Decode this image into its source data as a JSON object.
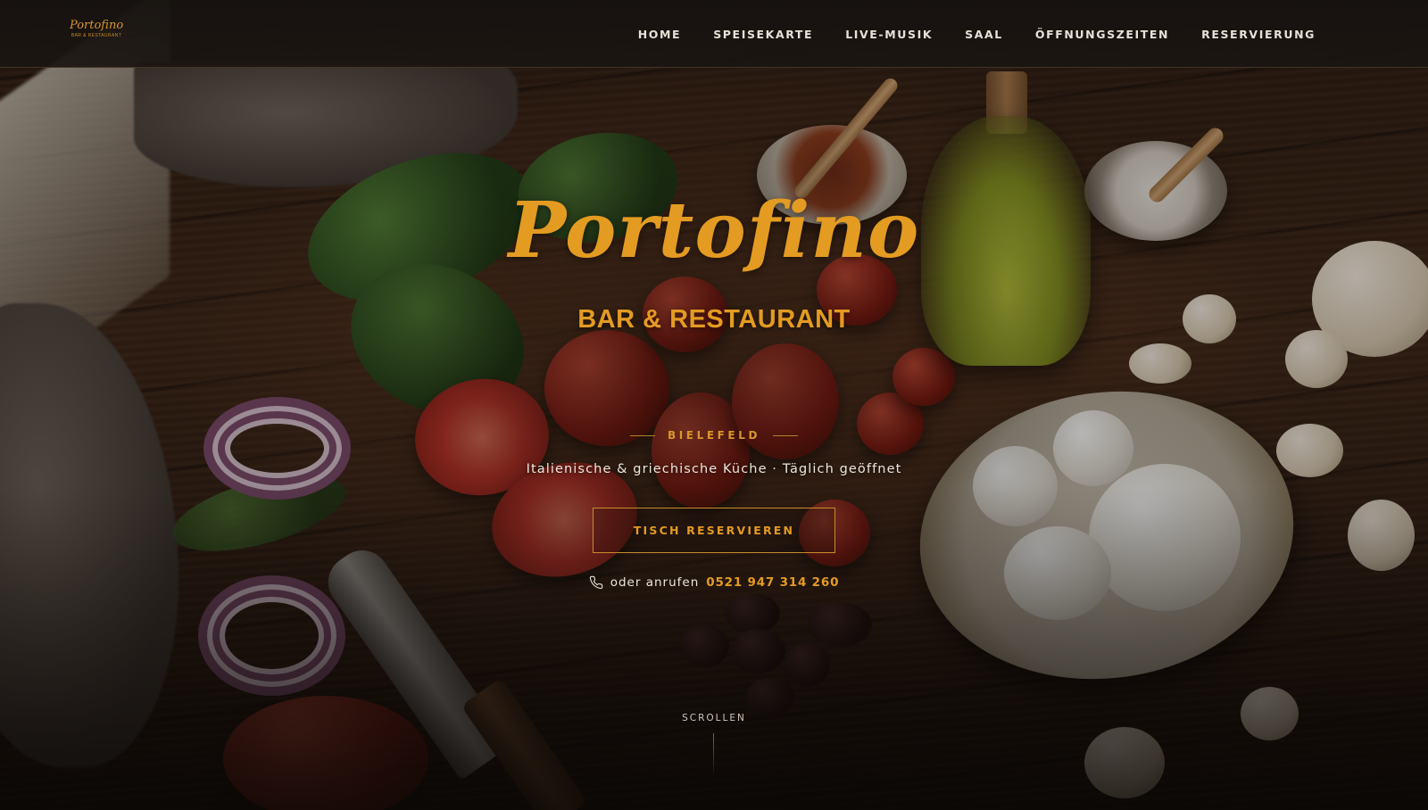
{
  "logo": {
    "script": "Portofino",
    "sub": "BAR & RESTAURANT"
  },
  "nav": {
    "items": [
      {
        "label": "HOME"
      },
      {
        "label": "SPEISEKARTE"
      },
      {
        "label": "LIVE-MUSIK"
      },
      {
        "label": "SAAL"
      },
      {
        "label": "ÖFFNUNGSZEITEN"
      },
      {
        "label": "RESERVIERUNG"
      }
    ]
  },
  "hero": {
    "title": "Portofino",
    "subtitle": "BAR & RESTAURANT",
    "location": "BIELEFELD",
    "tagline": "Italienische & griechische Küche  ·  Täglich geöffnet",
    "cta_label": "TISCH RESERVIEREN",
    "phone_prefix": "oder anrufen",
    "phone_number": "0521 947 314 260",
    "scroll_label": "SCROLLEN"
  },
  "colors": {
    "accent": "#e39b22",
    "nav_text": "#e8e1d7",
    "navbar_bg": "#1a1511"
  },
  "icons": {
    "phone": "phone-icon"
  }
}
